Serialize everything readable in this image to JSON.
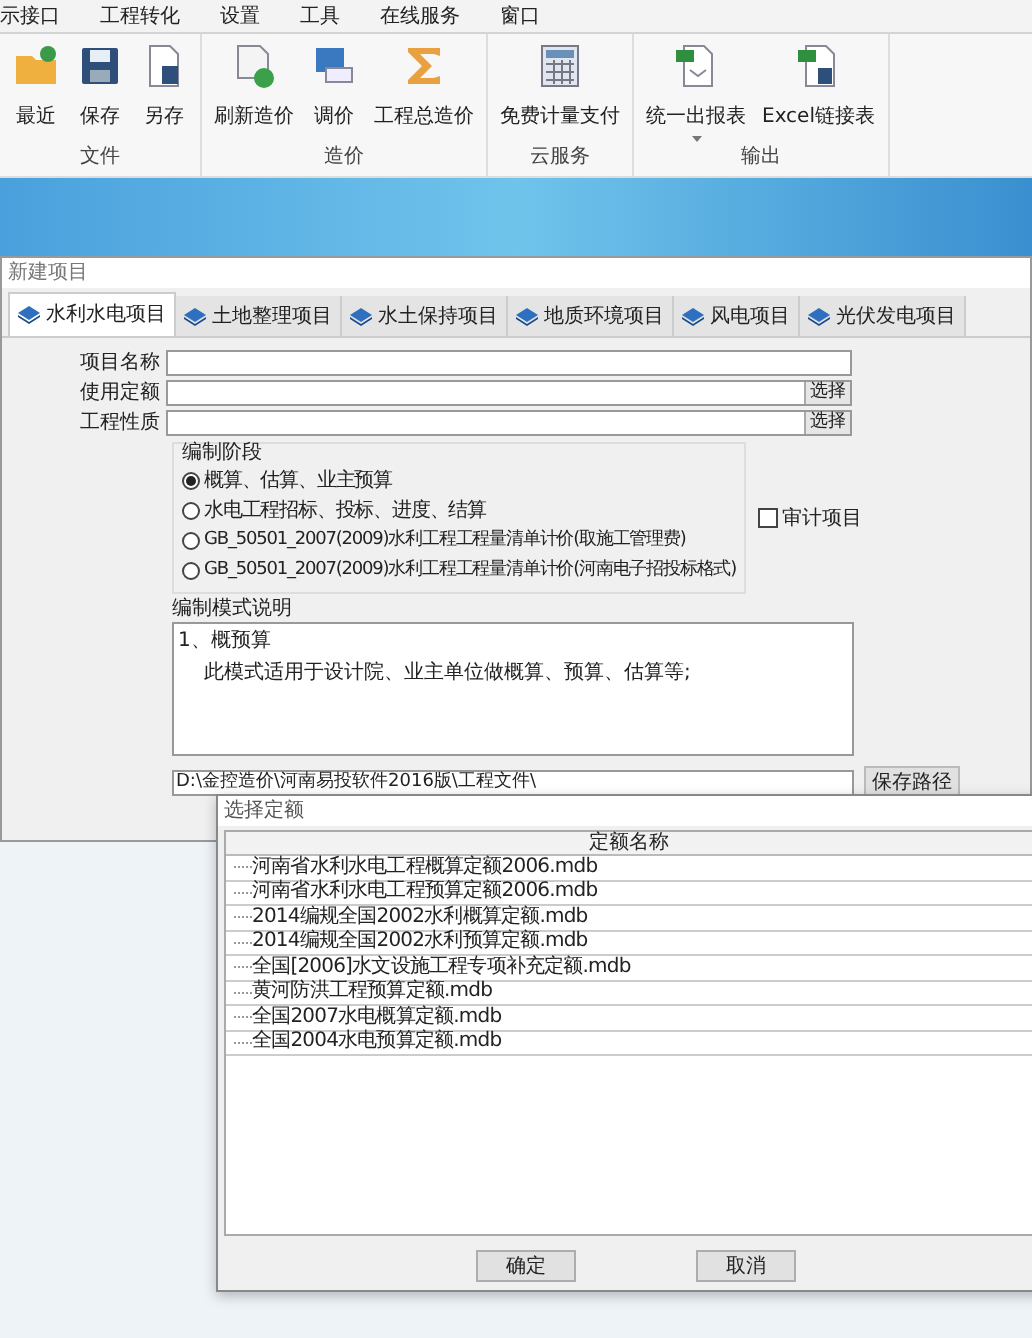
{
  "menu": [
    "示接口",
    "工程转化",
    "设置",
    "工具",
    "在线服务",
    "窗口"
  ],
  "ribbon": [
    {
      "label": "文件",
      "buttons": [
        {
          "label": "最近",
          "kind": "folder"
        },
        {
          "label": "保存",
          "kind": "save"
        },
        {
          "label": "另存",
          "kind": "saveas"
        }
      ]
    },
    {
      "label": "造价",
      "buttons": [
        {
          "label": "刷新造价",
          "kind": "refresh"
        },
        {
          "label": "调价",
          "kind": "formula"
        },
        {
          "label": "工程总造价",
          "kind": "sigma"
        }
      ]
    },
    {
      "label": "云服务",
      "buttons": [
        {
          "label": "免费计量支付",
          "kind": "calculator"
        }
      ]
    },
    {
      "label": "输出",
      "buttons": [
        {
          "label": "统一出报表",
          "kind": "report",
          "dropdown": true
        },
        {
          "label": "Excel链接表",
          "kind": "excel",
          "dropdown": false
        }
      ]
    }
  ],
  "project_window": {
    "title": "新建项目",
    "tabs": [
      {
        "label": "水利水电项目",
        "selected": true
      },
      {
        "label": "土地整理项目",
        "selected": false
      },
      {
        "label": "水土保持项目",
        "selected": false
      },
      {
        "label": "地质环境项目",
        "selected": false
      },
      {
        "label": "风电项目",
        "selected": false
      },
      {
        "label": "光伏发电项目",
        "selected": false
      }
    ],
    "fields": [
      {
        "label": "项目名称"
      },
      {
        "label": "使用定额",
        "button": "选择"
      },
      {
        "label": "工程性质",
        "button": "选择"
      }
    ],
    "stage": {
      "title": "编制阶段",
      "options": [
        {
          "label": "概算、估算、业主预算",
          "selected": true
        },
        {
          "label": "水电工程招标、投标、进度、结算",
          "selected": false
        },
        {
          "label": "GB_50501_2007(2009)水利工程工程量清单计价(取施工管理费)",
          "selected": false
        },
        {
          "label": "GB_50501_2007(2009)水利工程工程量清单计价(河南电子招投标格式)",
          "selected": false
        }
      ]
    },
    "audit": {
      "label": "审计项目",
      "checked": false
    },
    "mode_description": {
      "title": "编制模式说明",
      "lines": [
        "1、概预算",
        "此模式适用于设计院、业主单位做概算、预算、估算等;"
      ]
    },
    "save_path": {
      "value": "D:\\金控造价\\河南易投软件2016版\\工程文件\\",
      "button": "保存路径"
    }
  },
  "quota_dialog": {
    "title": "选择定额",
    "column": "定额名称",
    "rows": [
      "河南省水利水电工程概算定额2006.mdb",
      "河南省水利水电工程预算定额2006.mdb",
      "2014编规全国2002水利概算定额.mdb",
      "2014编规全国2002水利预算定额.mdb",
      "全国[2006]水文设施工程专项补充定额.mdb",
      "黄河防洪工程预算定额.mdb",
      "全国2007水电概算定额.mdb",
      "全国2004水电预算定额.mdb"
    ],
    "buttons": [
      "确定",
      "取消"
    ]
  }
}
